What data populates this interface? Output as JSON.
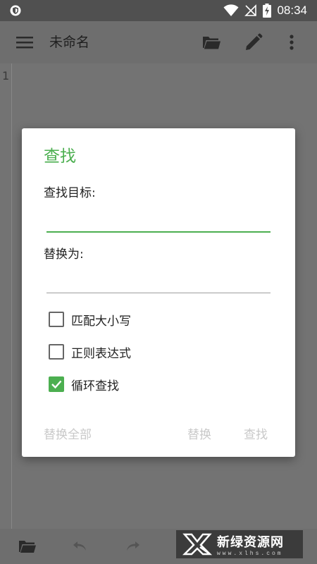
{
  "status_bar": {
    "time": "08:34",
    "icons": [
      "shield-icon",
      "wifi-icon",
      "no-signal-icon",
      "battery-charging-icon"
    ]
  },
  "app_bar": {
    "title": "未命名",
    "icons": [
      "menu-icon",
      "folder-open-icon",
      "pencil-icon",
      "more-vert-icon"
    ]
  },
  "editor": {
    "line_number": "1"
  },
  "dialog": {
    "title": "查找",
    "find_label": "查找目标:",
    "find_value": "",
    "replace_label": "替换为:",
    "replace_value": "",
    "options": [
      {
        "label": "匹配大小写",
        "checked": false
      },
      {
        "label": "正则表达式",
        "checked": false
      },
      {
        "label": "循环查找",
        "checked": true
      }
    ],
    "buttons": {
      "replace_all": "替换全部",
      "replace": "替换",
      "find": "查找"
    }
  },
  "bottom_bar": {
    "icons": [
      "folder-icon",
      "undo-icon",
      "redo-icon"
    ]
  },
  "watermark": {
    "name": "新绿资源网",
    "url": "www.xlhs.com"
  },
  "colors": {
    "accent": "#4caf50",
    "status_bar": "#505050",
    "app_bar": "#6e6e6e",
    "disabled_text": "#c9c9c9"
  }
}
